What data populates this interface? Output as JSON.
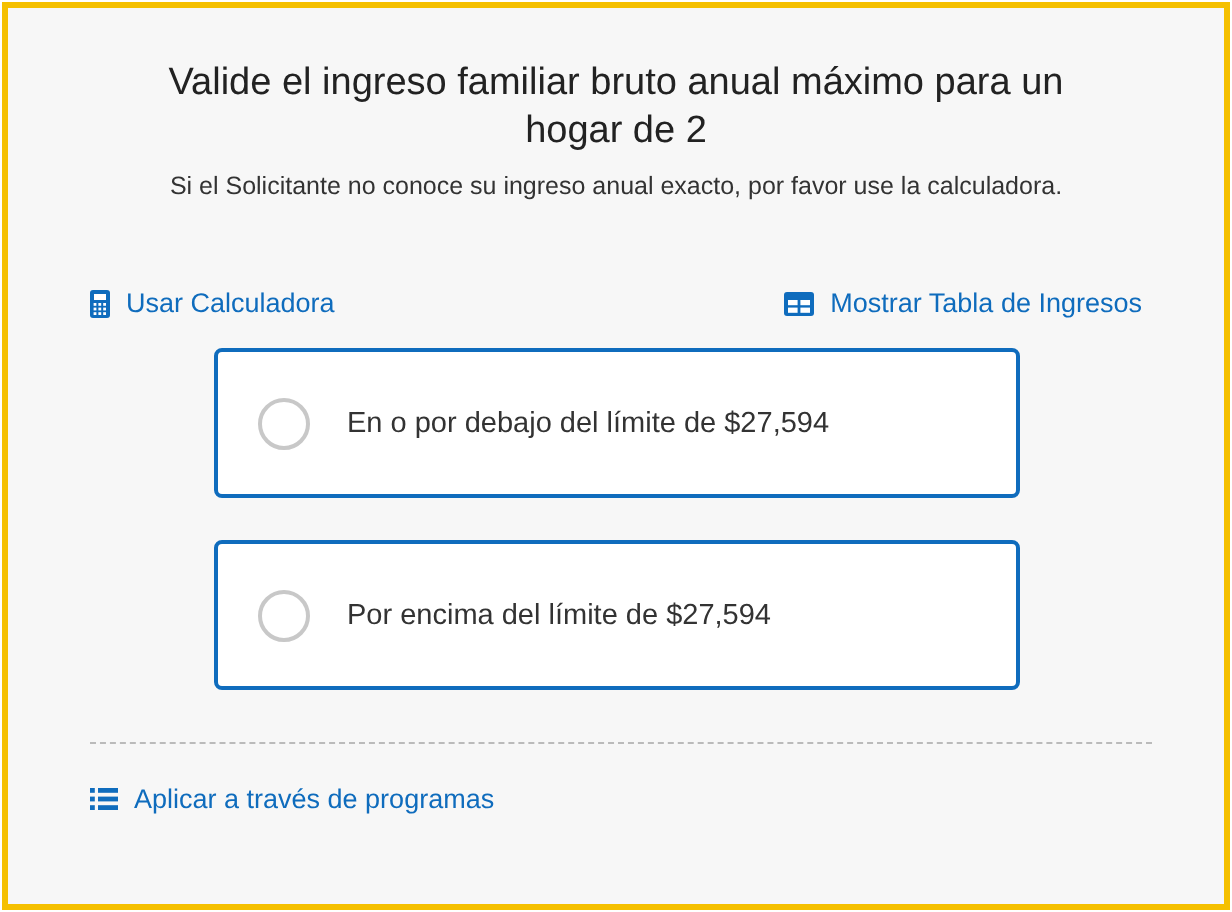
{
  "title": "Valide el ingreso familiar bruto anual máximo para un hogar de 2",
  "subtitle": "Si el Solicitante no conoce su ingreso anual exacto, por favor use la calculadora.",
  "links": [
    {
      "label": "Usar Calculadora",
      "kind": "calculator"
    },
    {
      "label": "Mostrar Tabla de Ingresos",
      "kind": "table"
    }
  ],
  "options": [
    {
      "label": "En o por debajo del límite de $27,594",
      "selected": false
    },
    {
      "label": "Por encima del límite de $27,594",
      "selected": false
    }
  ],
  "footer_link": {
    "label": "Aplicar a través de programas",
    "kind": "list"
  }
}
